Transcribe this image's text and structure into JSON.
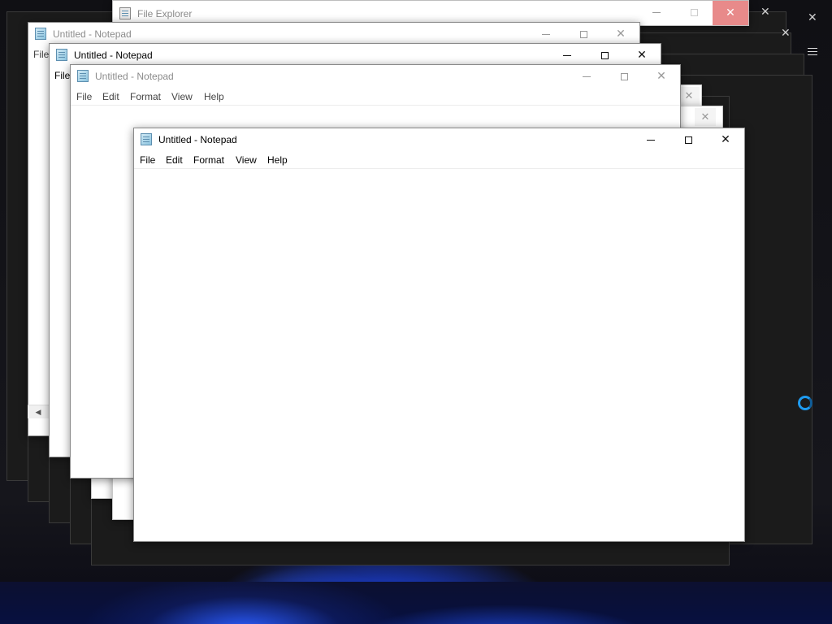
{
  "windows": {
    "explorer": {
      "title": "File Explorer"
    },
    "notepad_1": {
      "title": "Untitled - Notepad",
      "menu": [
        "File"
      ]
    },
    "notepad_2": {
      "title": "Untitled - Notepad",
      "menu": [
        "File"
      ]
    },
    "notepad_3": {
      "title": "Untitled - Notepad",
      "menu": [
        "File",
        "Edit",
        "Format",
        "View",
        "Help"
      ]
    },
    "notepad_active": {
      "title": "Untitled - Notepad",
      "menu": [
        "File",
        "Edit",
        "Format",
        "View",
        "Help"
      ]
    }
  },
  "icons": {
    "close": "✕",
    "scroll_left": "◀"
  },
  "colors": {
    "explorer_close_hover": "#e88a8a",
    "cursor_ring": "#1e9bf0"
  }
}
